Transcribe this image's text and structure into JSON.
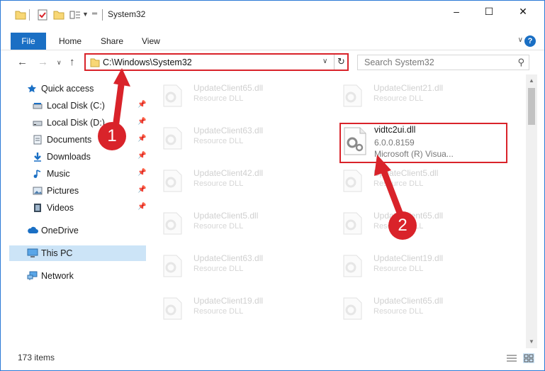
{
  "window": {
    "title": "System32",
    "controls": {
      "minimize": "–",
      "maximize": "☐",
      "close": "✕"
    }
  },
  "ribbon": {
    "tabs": [
      "File",
      "Home",
      "Share",
      "View"
    ],
    "help": "?"
  },
  "address": {
    "path": "C:\\Windows\\System32"
  },
  "search": {
    "placeholder": "Search System32"
  },
  "sidebar": {
    "items": [
      {
        "label": "Quick access",
        "icon": "star-icon"
      },
      {
        "label": "Local Disk (C:)",
        "icon": "drive-icon",
        "pinned": true
      },
      {
        "label": "Local Disk (D:)",
        "icon": "drive-icon",
        "pinned": true
      },
      {
        "label": "Documents",
        "icon": "documents-icon",
        "pinned": true
      },
      {
        "label": "Downloads",
        "icon": "download-icon",
        "pinned": true
      },
      {
        "label": "Music",
        "icon": "music-icon",
        "pinned": true
      },
      {
        "label": "Pictures",
        "icon": "pictures-icon",
        "pinned": true
      },
      {
        "label": "Videos",
        "icon": "videos-icon",
        "pinned": true
      },
      {
        "label": "OneDrive",
        "icon": "cloud-icon"
      },
      {
        "label": "This PC",
        "icon": "computer-icon",
        "selected": true
      },
      {
        "label": "Network",
        "icon": "network-icon"
      }
    ]
  },
  "files": {
    "left": [
      {
        "name": "UpdateClient65.dll",
        "desc": "Resource DLL"
      },
      {
        "name": "UpdateClient63.dll",
        "desc": "Resource DLL"
      },
      {
        "name": "UpdateClient42.dll",
        "desc": "Resource DLL"
      },
      {
        "name": "UpdateClient5.dll",
        "desc": "Resource DLL"
      },
      {
        "name": "UpdateClient63.dll",
        "desc": "Resource DLL"
      },
      {
        "name": "UpdateClient19.dll",
        "desc": "Resource DLL"
      }
    ],
    "right": [
      {
        "name": "UpdateClient21.dll",
        "desc": "Resource DLL"
      },
      {
        "name": "UpdateClient5.dll",
        "desc": "Resource DLL"
      },
      {
        "name": "UpdateClient65.dll",
        "desc": "Resource DLL"
      },
      {
        "name": "UpdateClient19.dll",
        "desc": "Resource DLL"
      },
      {
        "name": "UpdateClient65.dll",
        "desc": "Resource DLL"
      }
    ],
    "highlighted": {
      "name": "vidtc2ui.dll",
      "version": "6.0.0.8159",
      "desc": "Microsoft (R) Visua..."
    }
  },
  "status": {
    "item_count": "173 items"
  },
  "callouts": {
    "one": "1",
    "two": "2"
  },
  "colors": {
    "accent": "#1a6fc4",
    "callout": "#d9232a",
    "selection": "#cce4f7"
  }
}
